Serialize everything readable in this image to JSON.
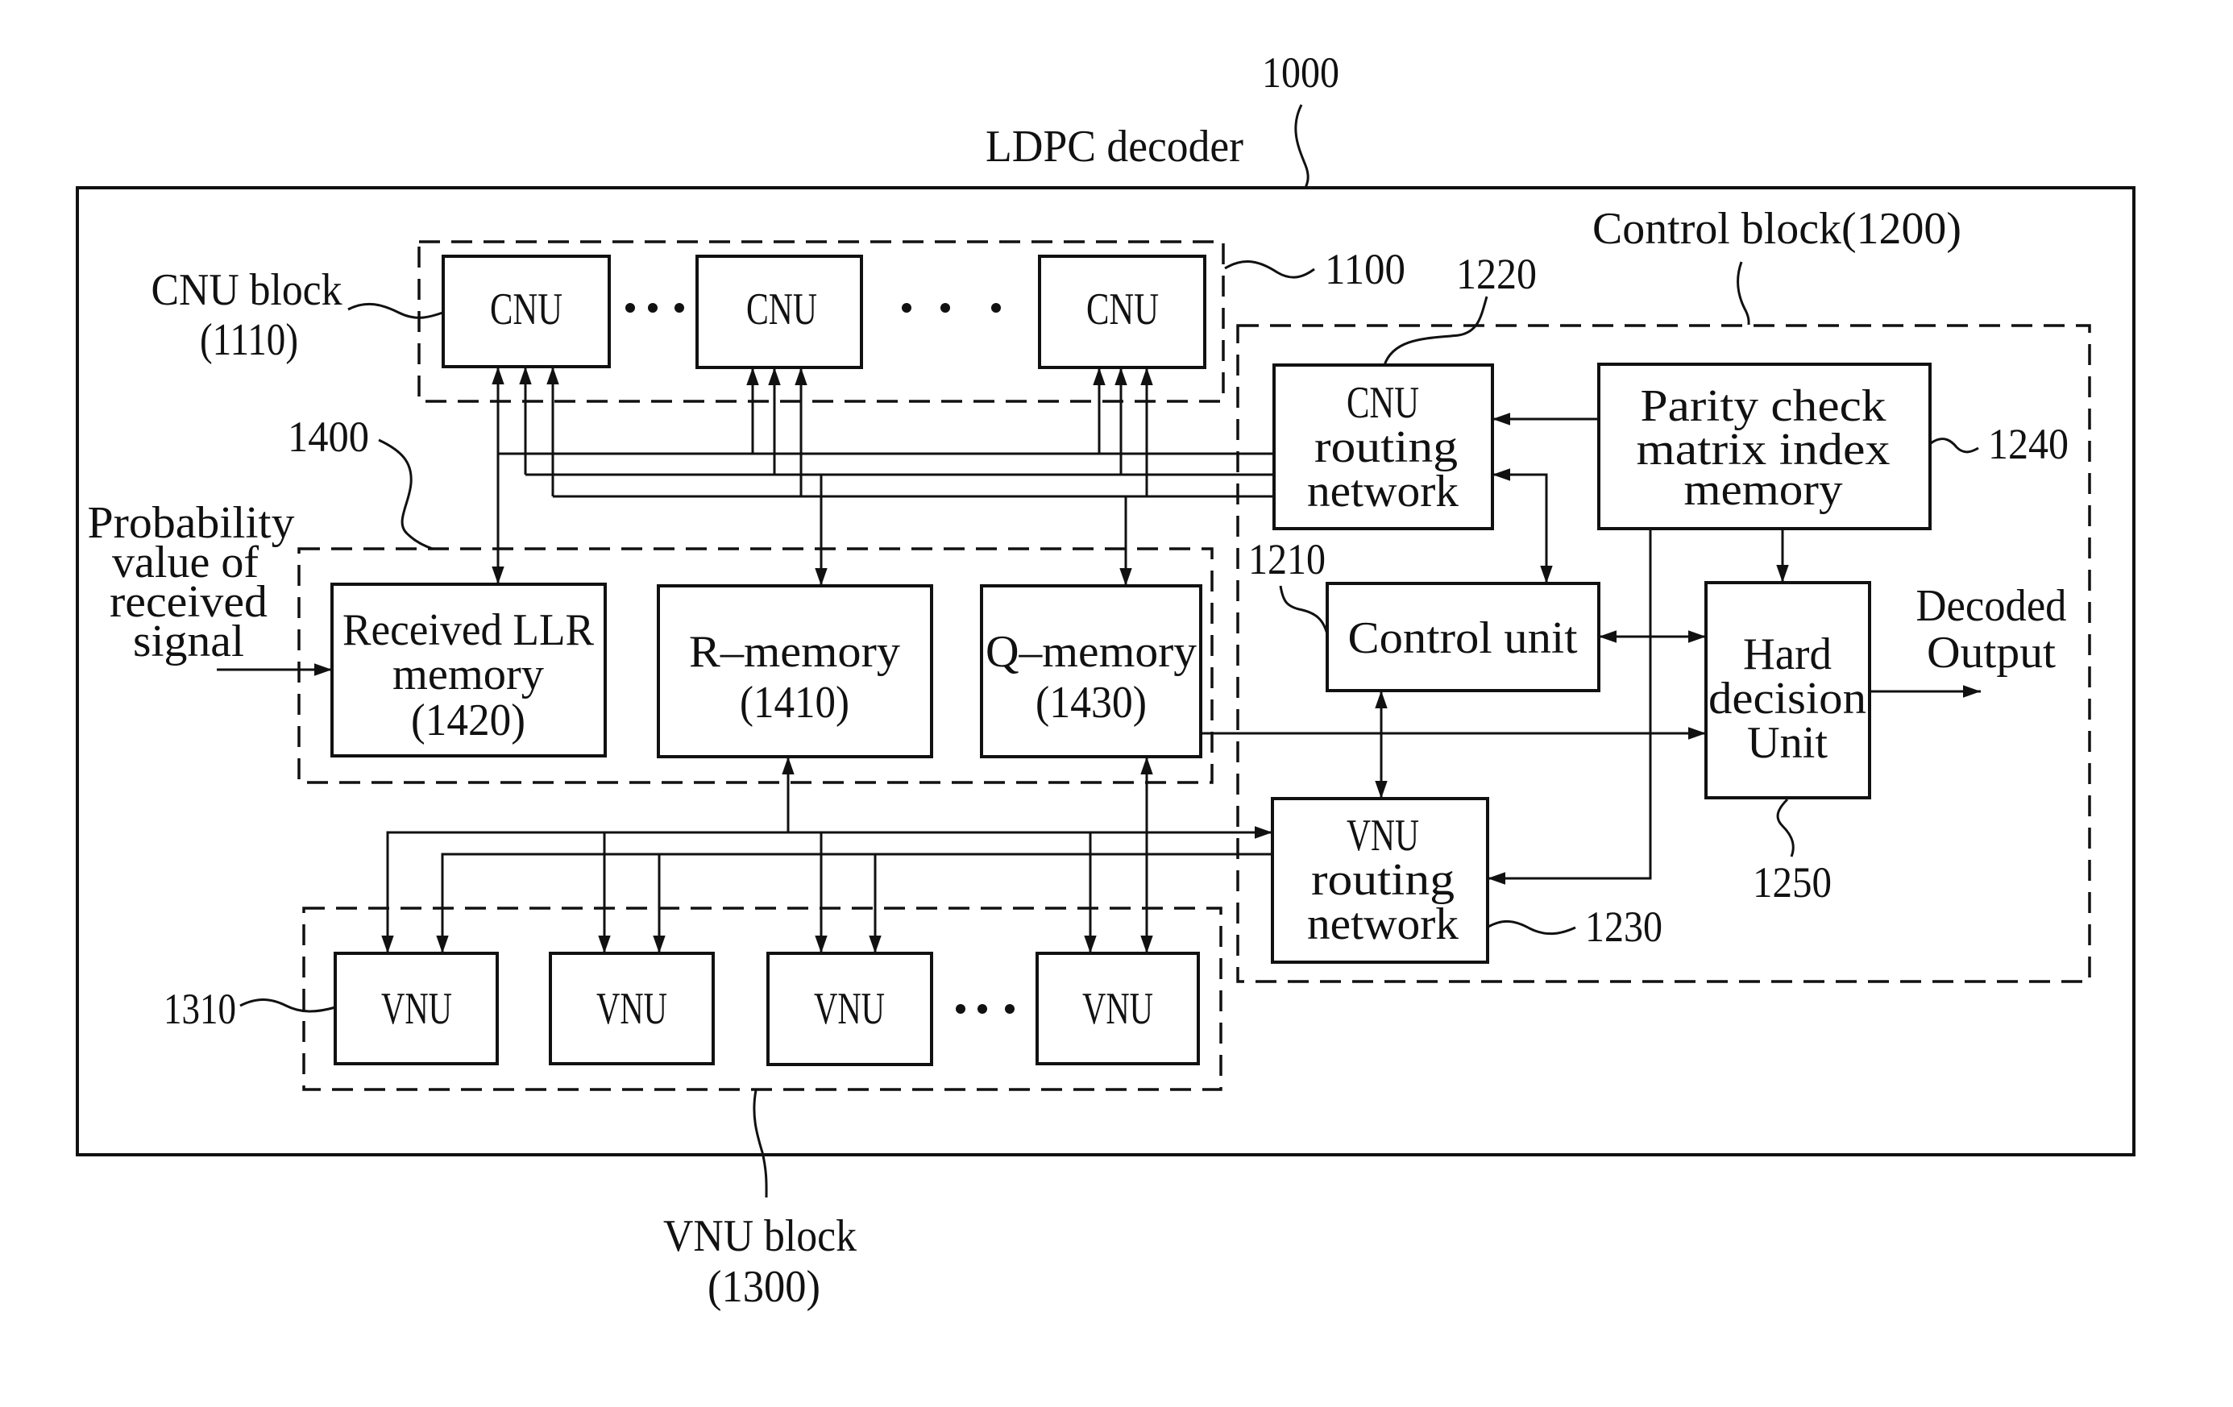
{
  "figure": {
    "title": "LDPC decoder",
    "ref_decoder": "1000",
    "input_label": [
      "Probability",
      "value of",
      "received",
      "signal"
    ],
    "output_label": [
      "Decoded",
      "Output"
    ]
  },
  "cnu_block": {
    "label": "CNU block",
    "label_ref": "(1110)",
    "ref": "1100",
    "unit_label": "CNU",
    "units": [
      "CNU",
      "CNU",
      "CNU"
    ],
    "ellipsis": "..."
  },
  "memory_block": {
    "ref": "1400",
    "received_llr": [
      "Received LLR",
      "memory",
      "(1420)"
    ],
    "r_memory": [
      "R–memory",
      "(1410)"
    ],
    "q_memory": [
      "Q–memory",
      "(1430)"
    ]
  },
  "vnu_block": {
    "label": "VNU block",
    "label_ref": "(1300)",
    "unit_ref": "1310",
    "units": [
      "VNU",
      "VNU",
      "VNU",
      "VNU"
    ],
    "ellipsis": "..."
  },
  "control_block": {
    "label": "Control block(1200)",
    "cnu_routing": [
      "CNU",
      "routing",
      "network"
    ],
    "cnu_routing_ref": "1220",
    "control_unit": "Control unit",
    "control_unit_ref": "1210",
    "vnu_routing": [
      "VNU",
      "routing",
      "network"
    ],
    "vnu_routing_ref": "1230",
    "parity_memory": [
      "Parity check",
      "matrix index",
      "memory"
    ],
    "parity_memory_ref": "1240",
    "hard_decision": [
      "Hard",
      "decision",
      "Unit"
    ],
    "hard_decision_ref": "1250"
  },
  "colors": {
    "ink": "#111111",
    "background": "#ffffff"
  }
}
